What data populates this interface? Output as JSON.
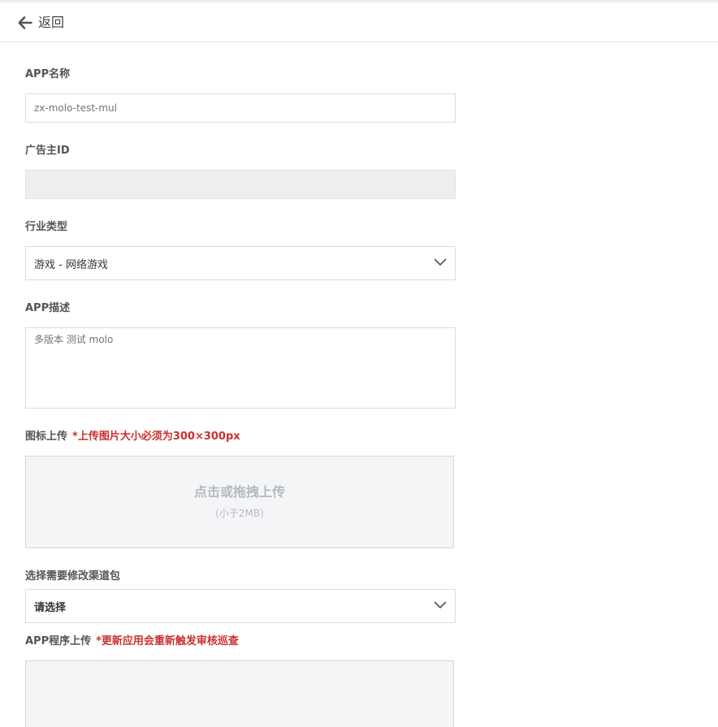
{
  "header": {
    "back_label": "返回",
    "back_icon": "arrow-left-icon"
  },
  "form": {
    "app_name": {
      "label": "APP名称",
      "placeholder": "zx-molo-test-mul"
    },
    "advertiser_id": {
      "label": "广告主ID",
      "value": ""
    },
    "industry": {
      "label": "行业类型",
      "selected": "游戏 - 网络游戏"
    },
    "description": {
      "label": "APP描述",
      "placeholder": "多版本 测试 molo"
    },
    "icon_upload": {
      "label": "图标上传",
      "note": "*上传图片大小必须为300×300px",
      "title": "点击或拖拽上传",
      "hint": "(小于2MB)"
    },
    "channel_package": {
      "label": "选择需要修改渠道包",
      "selected": "请选择"
    },
    "app_upload": {
      "label": "APP程序上传",
      "note": "*更新应用会重新触发审核巡查"
    }
  },
  "colors": {
    "note_red": "#c8322f",
    "upload_bg": "#f4f5f7",
    "disabled_bg": "#eeeeee"
  }
}
